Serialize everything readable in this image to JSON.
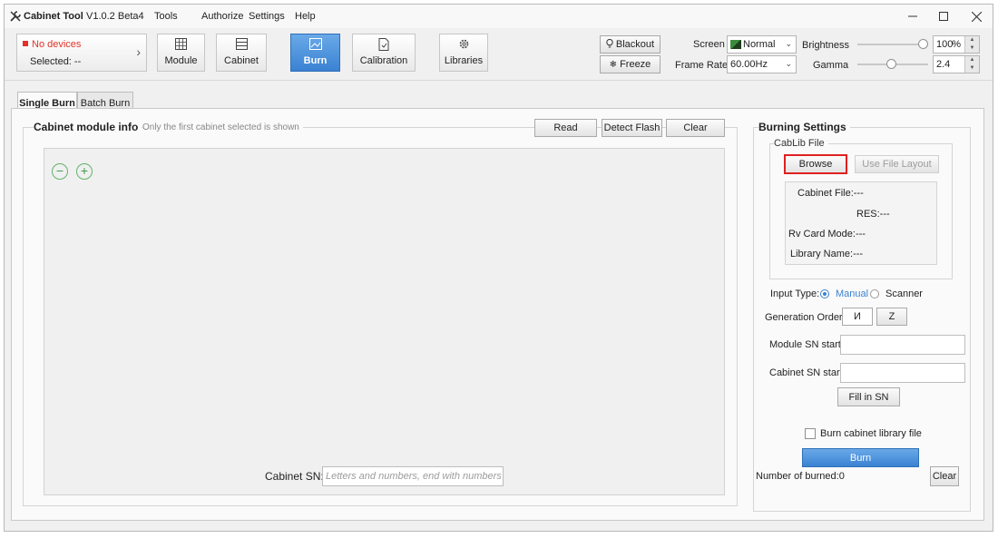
{
  "titlebar": {
    "app_name": "Cabinet Tool",
    "version": "V1.0.2 Beta4",
    "menu": [
      "Tools",
      "Authorize",
      "Settings",
      "Help"
    ],
    "window_controls": [
      "minimize-icon",
      "maximize-icon",
      "close-icon"
    ]
  },
  "device": {
    "status": "No devices",
    "selected": "Selected: --",
    "status_color": "#e2322a"
  },
  "toolbar": {
    "module": "Module",
    "cabinet": "Cabinet",
    "burn": "Burn",
    "calibration": "Calibration",
    "libraries": "Libraries",
    "blackout": "Blackout",
    "freeze": "Freeze",
    "active_color": "#3a82d2"
  },
  "display": {
    "screen_label": "Screen",
    "screen_value": "Normal",
    "frame_rate_label": "Frame Rate",
    "frame_rate_value": "60.00Hz",
    "brightness_label": "Brightness",
    "brightness_value": "100",
    "brightness_unit": "%",
    "brightness_level": 1.0,
    "gamma_label": "Gamma",
    "gamma_value": "2.4",
    "gamma_level": 0.48
  },
  "tabs": [
    "Single Burn",
    "Batch Burn"
  ],
  "module_info": {
    "title": "Cabinet module info",
    "hint": "Only the first cabinet selected is shown",
    "read": "Read",
    "detect_flash": "Detect Flash",
    "clear": "Clear",
    "zoom_out": "−",
    "zoom_in": "+",
    "cabinet_sn_label": "Cabinet SN:",
    "cabinet_sn_placeholder": "Letters and numbers, end with numbers"
  },
  "burning": {
    "title": "Burning Settings",
    "cablib_title": "CabLib File",
    "browse": "Browse",
    "use_file_layout": "Use File Layout",
    "cabinet_file": "Cabinet File:---",
    "res": "RES:---",
    "rv_card_mode": "Rv Card Mode:---",
    "library_name": "Library Name:---",
    "input_type_label": "Input Type:",
    "manual": "Manual",
    "scanner": "Scanner",
    "generation_order_label": "Generation Order:",
    "order_n": "И",
    "order_z": "Z",
    "module_sn_label": "Module SN start:",
    "cabinet_sn_start_label": "Cabinet SN start:",
    "module_sn_value": "",
    "cabinet_sn_value": "",
    "fill_in_sn": "Fill in SN",
    "burn_library_label": "Burn cabinet library file",
    "burn": "Burn",
    "number_burned": "Number of burned:0",
    "clear": "Clear",
    "highlight_color": "#e02020"
  }
}
